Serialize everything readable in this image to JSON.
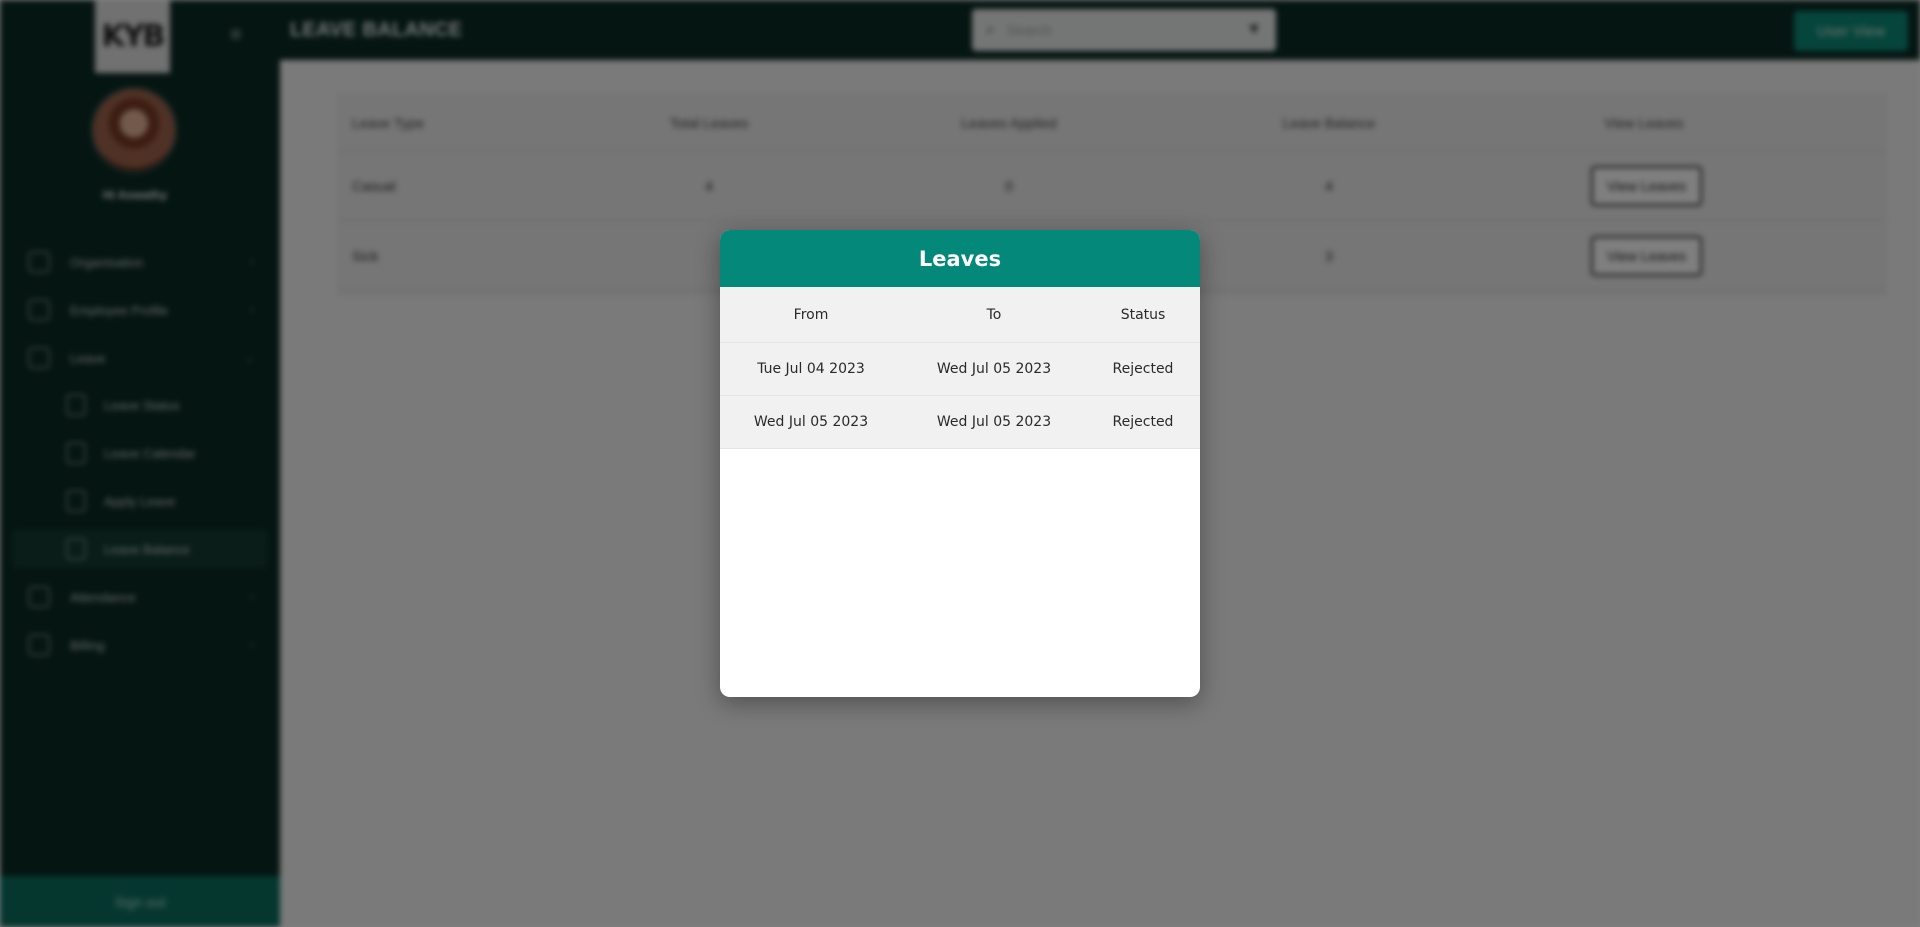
{
  "app": {
    "logo_text": "KYB",
    "user_greeting": "Hi Aswathy",
    "page_title": "LEAVE BALANCE",
    "search": {
      "placeholder": "Search"
    },
    "user_view_label": "User View",
    "sign_out_label": "Sign out"
  },
  "sidebar": {
    "items": [
      {
        "label": "Organisation",
        "icon": "building-icon",
        "chevron": "›"
      },
      {
        "label": "Employee Profile",
        "icon": "id-card-icon",
        "chevron": "›"
      },
      {
        "label": "Leave",
        "icon": "leave-icon",
        "chevron": "⌄"
      },
      {
        "label": "Attendance",
        "icon": "attendance-icon",
        "chevron": "›"
      },
      {
        "label": "Billing",
        "icon": "billing-icon",
        "chevron": "›"
      }
    ],
    "leave_sub_items": [
      {
        "label": "Leave Status",
        "icon": "document-icon"
      },
      {
        "label": "Leave Calendar",
        "icon": "calendar-icon"
      },
      {
        "label": "Apply Leave",
        "icon": "apply-icon"
      },
      {
        "label": "Leave Balance",
        "icon": "pie-chart-icon"
      }
    ]
  },
  "balance_table": {
    "headers": [
      "Leave Type",
      "Total Leaves",
      "Leaves Applied",
      "Leave Balance",
      "View Leaves"
    ],
    "rows": [
      {
        "type": "Casual",
        "total": "4",
        "applied": "0",
        "balance": "4",
        "action": "View Leaves"
      },
      {
        "type": "Sick",
        "total": "",
        "applied": "",
        "balance": "3",
        "action": "View Leaves"
      }
    ]
  },
  "modal": {
    "title": "Leaves",
    "headers": [
      "From",
      "To",
      "Status"
    ],
    "rows": [
      {
        "from": "Tue Jul 04 2023",
        "to": "Wed Jul 05 2023",
        "status": "Rejected"
      },
      {
        "from": "Wed Jul 05 2023",
        "to": "Wed Jul 05 2023",
        "status": "Rejected"
      }
    ]
  },
  "colors": {
    "sidebar_bg": "#0a2a23",
    "modal_header": "#04887a",
    "accent_button": "#0c8a77"
  }
}
